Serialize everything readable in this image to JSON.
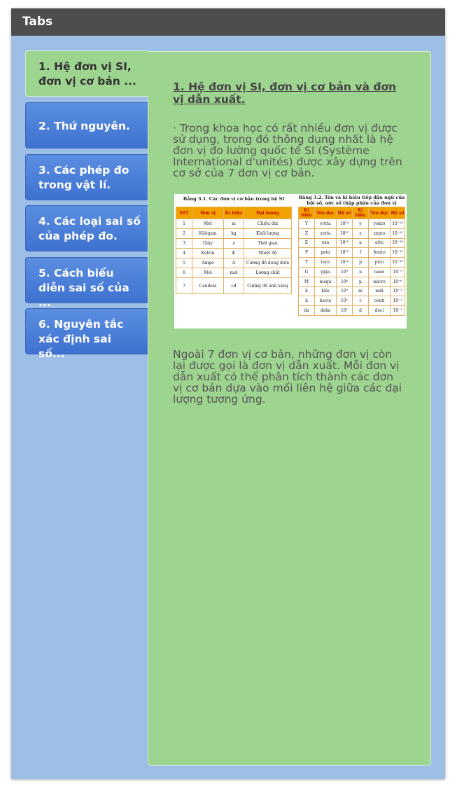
{
  "window": {
    "title": "Tabs"
  },
  "tabs": [
    {
      "line1": "1. Hệ đơn vị SI,",
      "line2": "đơn vị cơ bản ...",
      "active": true
    },
    {
      "line1": "2. Thứ nguyên.",
      "line2": "",
      "active": false
    },
    {
      "line1": "3. Các phép đo",
      "line2": "trong vật lí.",
      "active": false
    },
    {
      "line1": "4. Các loại sai số",
      "line2": "của phép đo.",
      "active": false
    },
    {
      "line1": "5. Cách biểu",
      "line2": "diễn sai số của ...",
      "active": false
    },
    {
      "line1": "6. Nguyên tắc",
      "line2": "xác định sai số...",
      "active": false
    }
  ],
  "panel": {
    "heading": "1. Hệ đơn vị SI, đơn vị cơ bản và đơn vị dẫn xuất.",
    "paragraph1": "· Trong khoa học có rất nhiều đơn vị được sử dụng, trong đó thông dụng nhất là hệ đơn vị đo lường quốc tế SI (Système International d'unités) được xây dựng trên cơ sở của 7 đơn vị cơ bản.",
    "paragraph2": "Ngoài 7 đơn vị cơ bản, những đơn vị còn lại được gọi là đơn vị dẫn xuất. Mỗi đơn vị dẫn xuất có thể phân tích thành các đơn vị cơ bản dựa vào mối liên hệ giữa các đại lượng tương ứng.",
    "table1": {
      "caption": "Bảng 3.1. Các đơn vị cơ bản trong hệ SI",
      "headers": [
        "STT",
        "Đơn vị",
        "Kí hiệu",
        "Đại lượng"
      ],
      "rows": [
        [
          "1",
          "Mét",
          "m",
          "Chiều dài"
        ],
        [
          "2",
          "Kilôgam",
          "kg",
          "Khối lượng"
        ],
        [
          "3",
          "Giây",
          "s",
          "Thời gian"
        ],
        [
          "4",
          "Kelvin",
          "K",
          "Nhiệt độ"
        ],
        [
          "5",
          "Ampe",
          "A",
          "Cường độ dòng điện"
        ],
        [
          "6",
          "Mol",
          "mol",
          "Lượng chất"
        ],
        [
          "7",
          "Candela",
          "cd",
          "Cường độ ánh sáng"
        ]
      ]
    },
    "table2": {
      "caption": "Bảng 3.2. Tên và kí hiệu tiếp đầu ngữ của bội số, ước số thập phân của đơn vị",
      "headers": [
        "Kí hiệu",
        "Tên đọc",
        "Hệ số",
        "Kí hiệu",
        "Tên đọc",
        "Hệ số"
      ],
      "rows": [
        [
          "Y",
          "yotta",
          "10²⁴",
          "y",
          "yokto",
          "10⁻²⁴"
        ],
        [
          "Z",
          "zetta",
          "10²¹",
          "z",
          "zepto",
          "10⁻²¹"
        ],
        [
          "E",
          "exa",
          "10¹⁸",
          "a",
          "atto",
          "10⁻¹⁸"
        ],
        [
          "P",
          "peta",
          "10¹⁵",
          "f",
          "femto",
          "10⁻¹⁵"
        ],
        [
          "T",
          "tera",
          "10¹²",
          "p",
          "pico",
          "10⁻¹²"
        ],
        [
          "G",
          "giga",
          "10⁹",
          "n",
          "nano",
          "10⁻⁹"
        ],
        [
          "M",
          "mega",
          "10⁶",
          "µ",
          "micro",
          "10⁻⁶"
        ],
        [
          "k",
          "kilo",
          "10³",
          "m",
          "mili",
          "10⁻³"
        ],
        [
          "h",
          "hecto",
          "10²",
          "c",
          "centi",
          "10⁻²"
        ],
        [
          "da",
          "deka",
          "10¹",
          "d",
          "deci",
          "10⁻¹"
        ]
      ]
    }
  }
}
